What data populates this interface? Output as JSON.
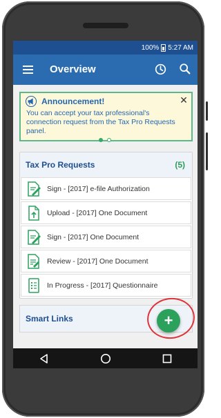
{
  "status_bar": {
    "battery_level": "100%",
    "time": "5:27 AM"
  },
  "app_bar": {
    "title": "Overview",
    "icons": [
      "menu-icon",
      "clock-icon",
      "search-icon"
    ]
  },
  "announcement": {
    "title": "Announcement!",
    "body": "You can accept your tax professional's connection request from the Tax Pro Requests panel.",
    "close_label": "✕",
    "pages": 2,
    "active_page": 1
  },
  "tax_pro_requests": {
    "title": "Tax Pro Requests",
    "count": "(5)",
    "items": [
      {
        "label": "Sign - [2017] e-file Authorization",
        "icon": "sign-document-icon"
      },
      {
        "label": "Upload - [2017] One Document",
        "icon": "upload-document-icon"
      },
      {
        "label": "Sign - [2017] One Document",
        "icon": "sign-document-icon"
      },
      {
        "label": "Review - [2017] One Document",
        "icon": "review-document-icon"
      },
      {
        "label": "In Progress - [2017] Questionnaire",
        "icon": "questionnaire-icon"
      }
    ]
  },
  "smart_links": {
    "title": "Smart Links"
  },
  "fab": {
    "label": "+"
  },
  "colors": {
    "status_bar": "#1d4f91",
    "app_bar": "#2b6cb0",
    "accent_green": "#2ba15c",
    "announcement_bg": "#fdf8da",
    "highlight_ring": "#e0323a"
  }
}
